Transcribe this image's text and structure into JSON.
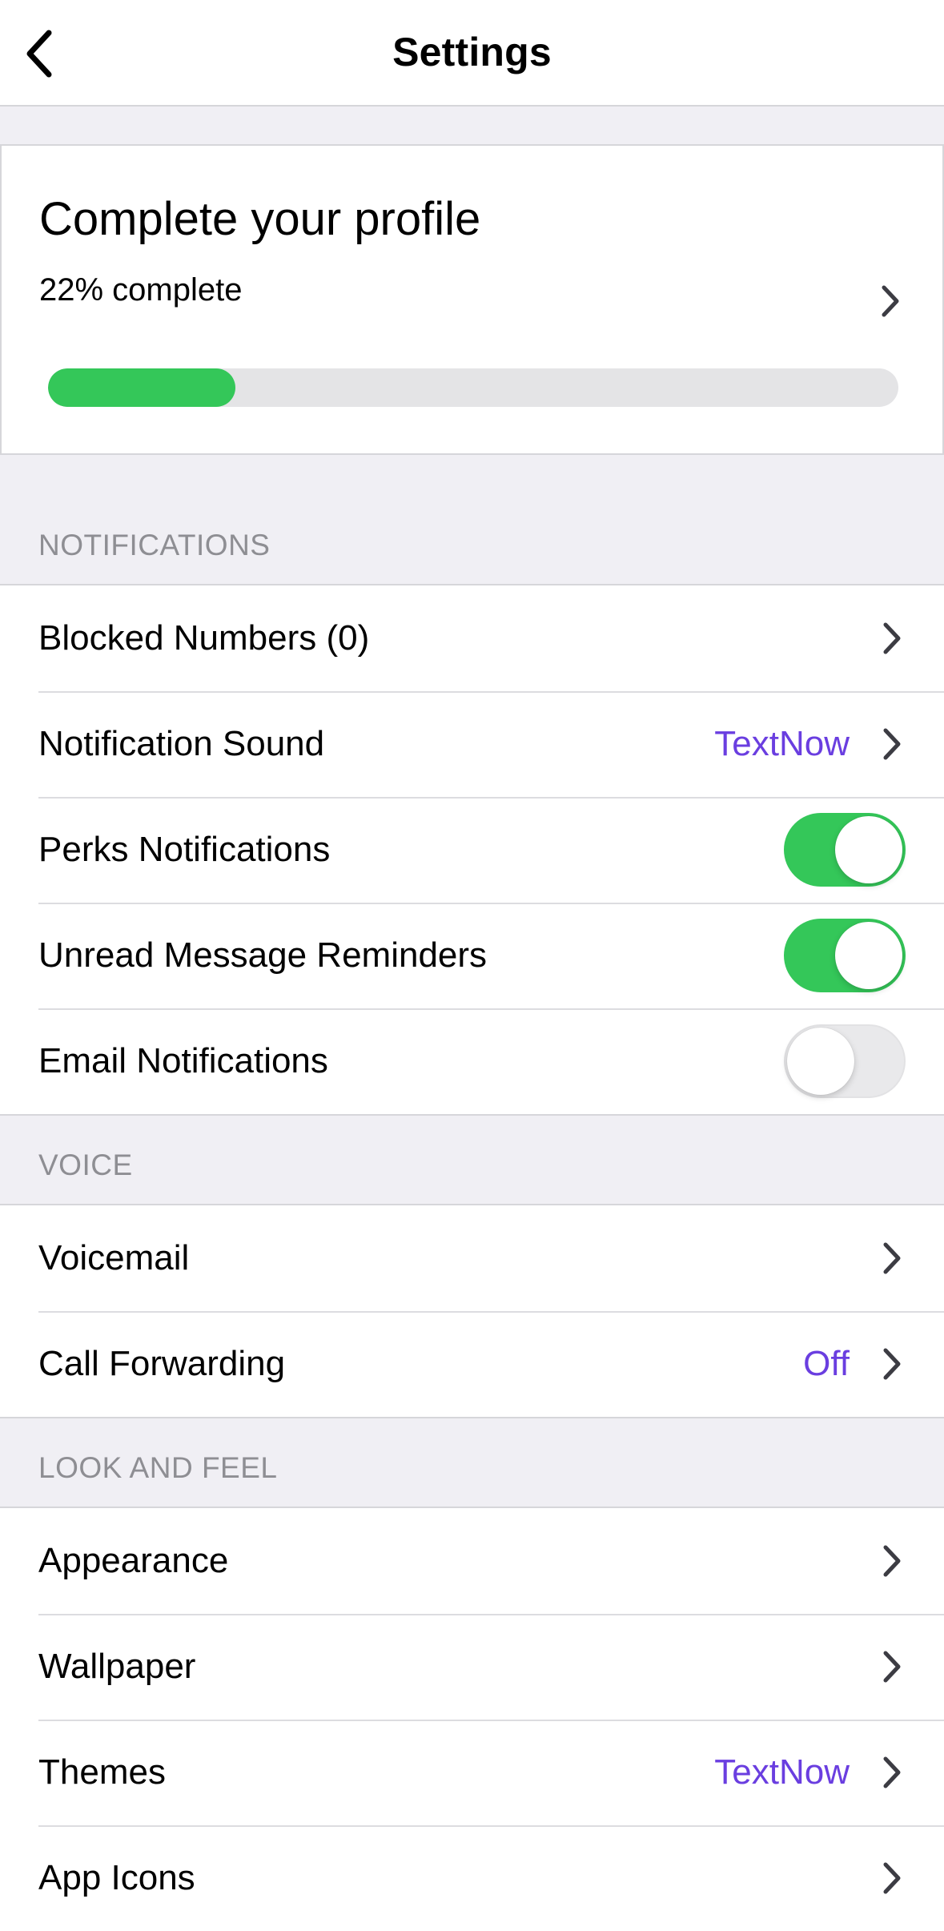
{
  "nav": {
    "title": "Settings"
  },
  "profile": {
    "title": "Complete your profile",
    "progress_text": "22% complete",
    "progress_fraction": 0.22,
    "progress_color": "#34c759"
  },
  "sections": {
    "notifications": "NOTIFICATIONS",
    "voice": "VOICE",
    "look_and_feel": "LOOK AND FEEL"
  },
  "notifications": {
    "blocked_numbers": "Blocked Numbers (0)",
    "notification_sound": "Notification Sound",
    "notification_sound_value": "TextNow",
    "perks_notifications": "Perks Notifications",
    "perks_notifications_on": true,
    "unread_reminders": "Unread Message Reminders",
    "unread_reminders_on": true,
    "email_notifications": "Email Notifications",
    "email_notifications_on": false
  },
  "voice": {
    "voicemail": "Voicemail",
    "call_forwarding": "Call Forwarding",
    "call_forwarding_value": "Off"
  },
  "look_and_feel": {
    "appearance": "Appearance",
    "wallpaper": "Wallpaper",
    "themes": "Themes",
    "themes_value": "TextNow",
    "app_icons": "App Icons"
  },
  "colors": {
    "accent_value": "#6a3ee0",
    "toggle_on": "#34c759",
    "background": "#f0eff4"
  },
  "icons": {
    "back": "chevron-left-icon",
    "disclosure": "chevron-right-icon"
  }
}
